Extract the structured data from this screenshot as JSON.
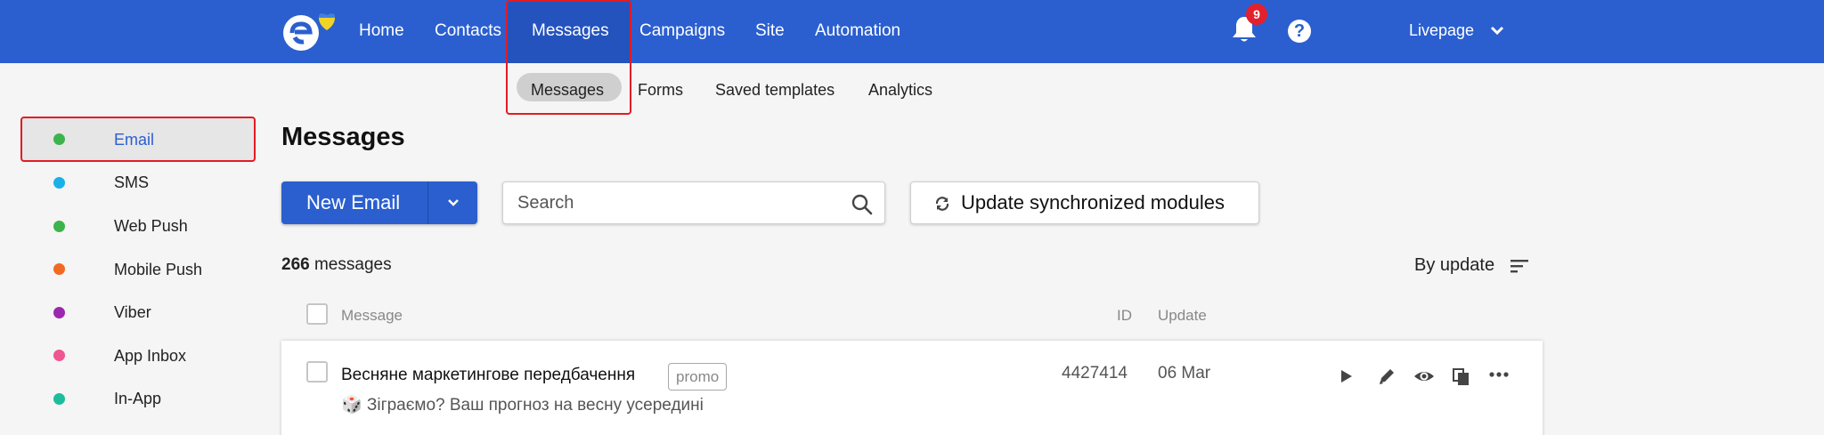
{
  "nav": {
    "items": [
      {
        "label": "Home"
      },
      {
        "label": "Contacts"
      },
      {
        "label": "Messages"
      },
      {
        "label": "Campaigns"
      },
      {
        "label": "Site"
      },
      {
        "label": "Automation"
      }
    ],
    "active": "Messages",
    "notifications_count": "9",
    "help_label": "?",
    "account_name": "Livepage"
  },
  "subnav": {
    "items": [
      {
        "label": "Messages"
      },
      {
        "label": "Forms"
      },
      {
        "label": "Saved templates"
      },
      {
        "label": "Analytics"
      }
    ],
    "active": "Messages"
  },
  "sidebar": {
    "items": [
      {
        "label": "Email",
        "color": "#3cb44b"
      },
      {
        "label": "SMS",
        "color": "#1ab0e8"
      },
      {
        "label": "Web Push",
        "color": "#3cb44b"
      },
      {
        "label": "Mobile Push",
        "color": "#f26a21"
      },
      {
        "label": "Viber",
        "color": "#9c27b0"
      },
      {
        "label": "App Inbox",
        "color": "#f0568f"
      },
      {
        "label": "In-App",
        "color": "#1ebc9c"
      }
    ],
    "selected": "Email"
  },
  "main": {
    "title": "Messages",
    "new_button_label": "New Email",
    "search_placeholder": "Search",
    "sync_button_label": "Update synchronized modules",
    "count_number": "266",
    "count_suffix": "messages",
    "sort_label": "By update",
    "columns": {
      "message": "Message",
      "id": "ID",
      "update": "Update"
    },
    "rows": [
      {
        "title": "Весняне маркетингове передбачення",
        "tag": "promo",
        "subject": "🎲 Зіграємо? Ваш прогноз на весну усередині",
        "id": "4427414",
        "date": "06 Mar"
      }
    ]
  },
  "colors": {
    "brand": "#2b5fcf",
    "highlight": "#e21b24",
    "badge": "#e3202d"
  },
  "icons": [
    "logo-icon",
    "bell-icon",
    "help-icon",
    "chevron-down-icon",
    "caret-down-icon",
    "search-icon",
    "sync-icon",
    "sort-icon",
    "play-icon",
    "edit-icon",
    "preview-icon",
    "copy-icon",
    "more-icon"
  ]
}
